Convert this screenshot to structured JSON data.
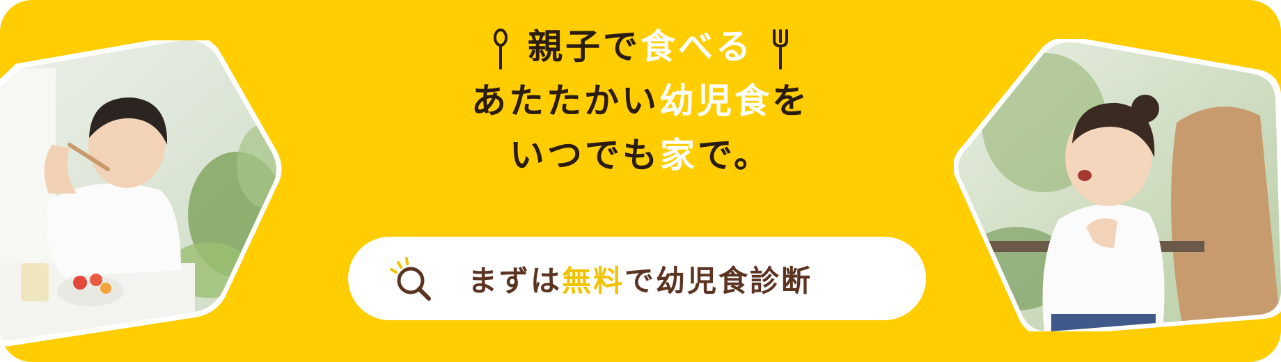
{
  "headline": {
    "line1_dark": "親子で",
    "line1_highlight": "食べる",
    "line2_dark": "あたたかい",
    "line2_highlight": "幼児食",
    "line2_suffix": "を",
    "line3_dark": "いつでも",
    "line3_highlight": "家",
    "line3_suffix": "で。"
  },
  "icons": {
    "left": "spoon-icon",
    "right": "fork-icon",
    "cta": "search-icon"
  },
  "cta": {
    "prefix": "まずは",
    "highlight": "無料",
    "suffix": "で幼児食診断"
  },
  "colors": {
    "background": "#ffcd00",
    "headline_text": "#2b1c12",
    "headline_highlight": "#ffffff",
    "cta_background": "#ffffff",
    "cta_text": "#5b3321",
    "cta_highlight": "#f2c300"
  }
}
